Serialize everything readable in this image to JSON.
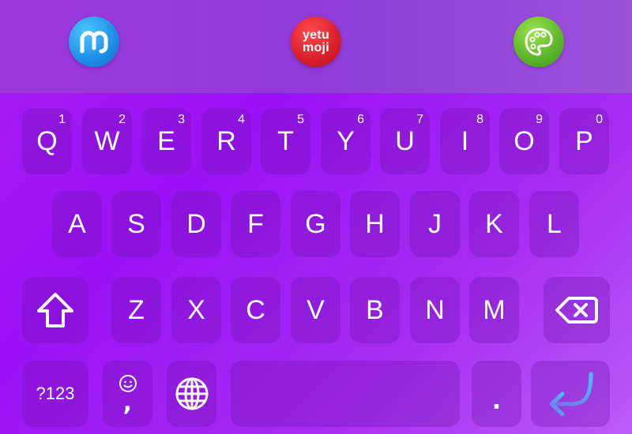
{
  "toolbar": {
    "icons": [
      "mastodon-icon",
      "yetumoji-icon",
      "palette-icon"
    ],
    "yetumoji_line1": "yetu",
    "yetumoji_line2": "moji"
  },
  "keyboard": {
    "row1": [
      {
        "label": "Q",
        "hint": "1"
      },
      {
        "label": "W",
        "hint": "2"
      },
      {
        "label": "E",
        "hint": "3"
      },
      {
        "label": "R",
        "hint": "4"
      },
      {
        "label": "T",
        "hint": "5"
      },
      {
        "label": "Y",
        "hint": "6"
      },
      {
        "label": "U",
        "hint": "7"
      },
      {
        "label": "I",
        "hint": "8"
      },
      {
        "label": "O",
        "hint": "9"
      },
      {
        "label": "P",
        "hint": "0"
      }
    ],
    "row2": [
      "A",
      "S",
      "D",
      "F",
      "G",
      "H",
      "J",
      "K",
      "L"
    ],
    "row3": [
      "Z",
      "X",
      "C",
      "V",
      "B",
      "N",
      "M"
    ],
    "symbols_label": "?123",
    "emoji_comma": ",",
    "period": ".",
    "icons": {
      "shift": "shift-icon",
      "backspace": "backspace-icon",
      "emoji": "emoji-icon",
      "globe": "globe-icon",
      "enter": "enter-icon"
    }
  },
  "colors": {
    "background": "#a41cf0",
    "toolbar": "#9a37da",
    "key": "#7a1fb8",
    "text": "#ffffff",
    "enter_accent": "#5aa9f0"
  }
}
